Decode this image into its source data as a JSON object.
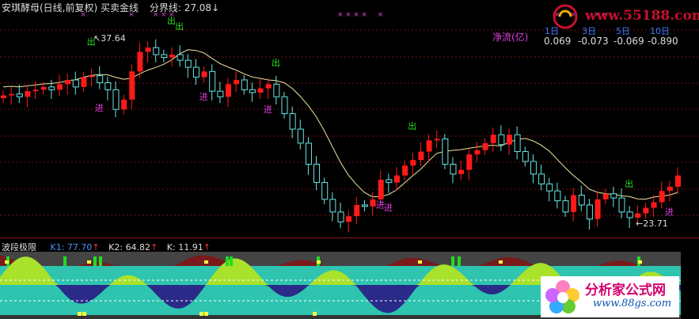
{
  "header": {
    "title": "安琪酵母(日线,前复权) 买卖金线",
    "boundary_label": "分界线:",
    "boundary_value": "27.08",
    "boundary_arrow": "↓"
  },
  "watermark": {
    "text": "www.55188.com"
  },
  "net_flow": {
    "label": "净流(亿)",
    "periods": [
      "1日",
      "3日",
      "5日",
      "10日"
    ],
    "values": [
      "0.069",
      "-0.073",
      "-0.069",
      "-0.890"
    ]
  },
  "annotations": {
    "high_label": "37.64",
    "low_label": "23.71",
    "out_label": "出",
    "in_label": "进"
  },
  "indicator": {
    "name": "波段极限",
    "k1_label": "K1:",
    "k1_value": "77.70",
    "k2_label": "K2:",
    "k2_value": "64.82",
    "k_label": "K:",
    "k_value": "11.91",
    "arrow": "↑"
  },
  "brand": {
    "title": "分析家公式网",
    "url": "www.88gs.com"
  },
  "colors": {
    "up": "#ff1a1a",
    "down": "#66e6e6",
    "gold_line": "#f0e6a0",
    "magenta": "#e040e0",
    "green_signal": "#22dd22",
    "ind_cyan": "#2ec4b0",
    "ind_lime": "#a8e22a",
    "ind_navy": "#2a2a88",
    "ind_maroon": "#7a1a1a"
  },
  "chart_data": [
    {
      "type": "candlestick",
      "title": "安琪酵母(日线,前复权) 买卖金线",
      "series": [
        {
          "name": "close_approx",
          "values": [
            32.5,
            32.6,
            32.4,
            32.8,
            32.9,
            33.1,
            32.9,
            33.3,
            33.6,
            33.1,
            33.8,
            33.9,
            33.4,
            32.9,
            31.5,
            32.2,
            34.2,
            35.6,
            35.9,
            35.4,
            35.2,
            35.4,
            35.0,
            34.5,
            33.8,
            34.2,
            32.8,
            32.4,
            33.3,
            33.6,
            32.9,
            32.7,
            33.0,
            33.3,
            32.4,
            31.2,
            30.1,
            29.1,
            27.6,
            26.3,
            25.1,
            24.2,
            23.5,
            23.9,
            24.7,
            24.6,
            25.1,
            26.5,
            26.3,
            26.8,
            27.5,
            27.9,
            28.5,
            29.3,
            29.4,
            27.6,
            26.9,
            27.2,
            28.3,
            28.6,
            29.1,
            29.7,
            29.0,
            29.7,
            28.5,
            27.8,
            26.9,
            26.2,
            25.7,
            25.0,
            24.2,
            25.4,
            24.7,
            23.7,
            25.1,
            25.5,
            25.2,
            24.2,
            23.8,
            24.1,
            24.5,
            24.9,
            25.7,
            26.0,
            26.8
          ]
        }
      ],
      "ylim": [
        22.5,
        38.5
      ],
      "annotations": [
        "37.64",
        "23.71"
      ]
    },
    {
      "type": "area",
      "title": "波段极限",
      "series": [
        {
          "name": "K1",
          "last": 77.7
        },
        {
          "name": "K2",
          "last": 64.82
        },
        {
          "name": "K",
          "last": 11.91
        }
      ]
    }
  ]
}
